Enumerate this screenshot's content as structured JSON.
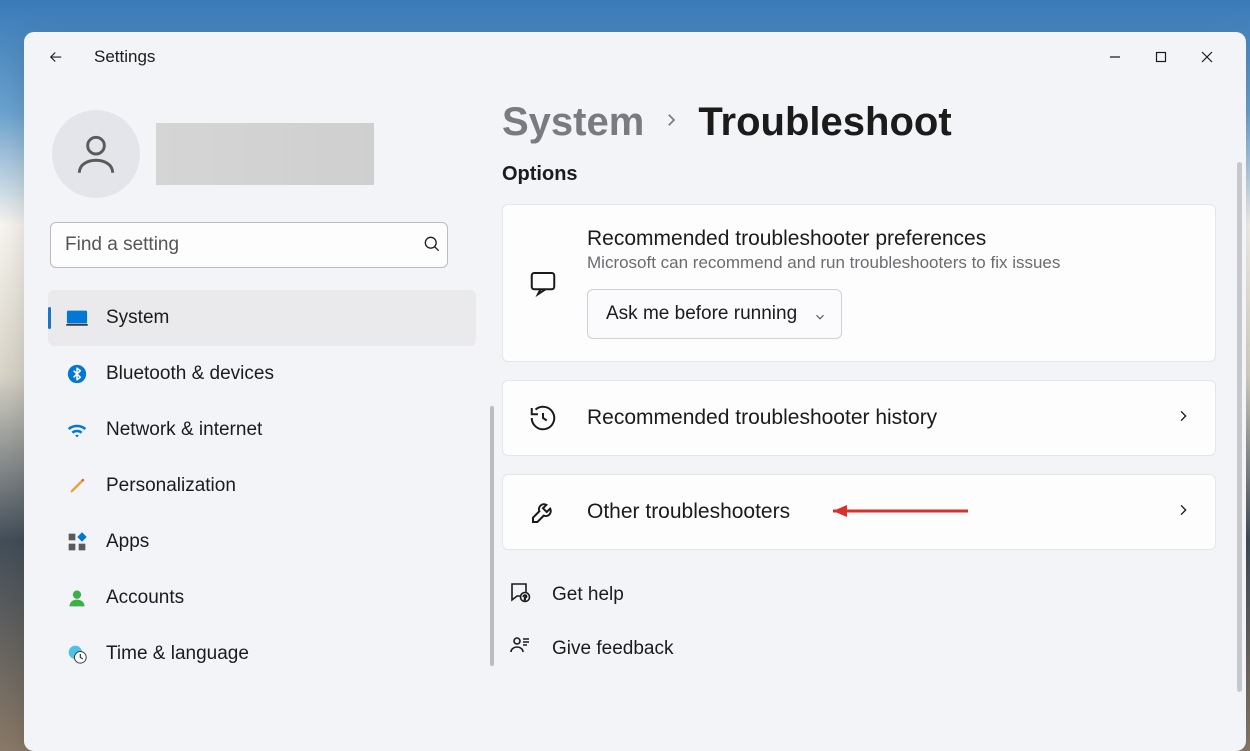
{
  "app_title": "Settings",
  "search": {
    "placeholder": "Find a setting"
  },
  "nav": {
    "items": [
      {
        "label": "System"
      },
      {
        "label": "Bluetooth & devices"
      },
      {
        "label": "Network & internet"
      },
      {
        "label": "Personalization"
      },
      {
        "label": "Apps"
      },
      {
        "label": "Accounts"
      },
      {
        "label": "Time & language"
      }
    ]
  },
  "breadcrumb": {
    "parent": "System",
    "current": "Troubleshoot"
  },
  "section_label": "Options",
  "cards": {
    "prefs": {
      "title": "Recommended troubleshooter preferences",
      "sub": "Microsoft can recommend and run troubleshooters to fix issues",
      "select_value": "Ask me before running"
    },
    "history": {
      "title": "Recommended troubleshooter history"
    },
    "other": {
      "title": "Other troubleshooters"
    }
  },
  "footer": {
    "help": "Get help",
    "feedback": "Give feedback"
  }
}
